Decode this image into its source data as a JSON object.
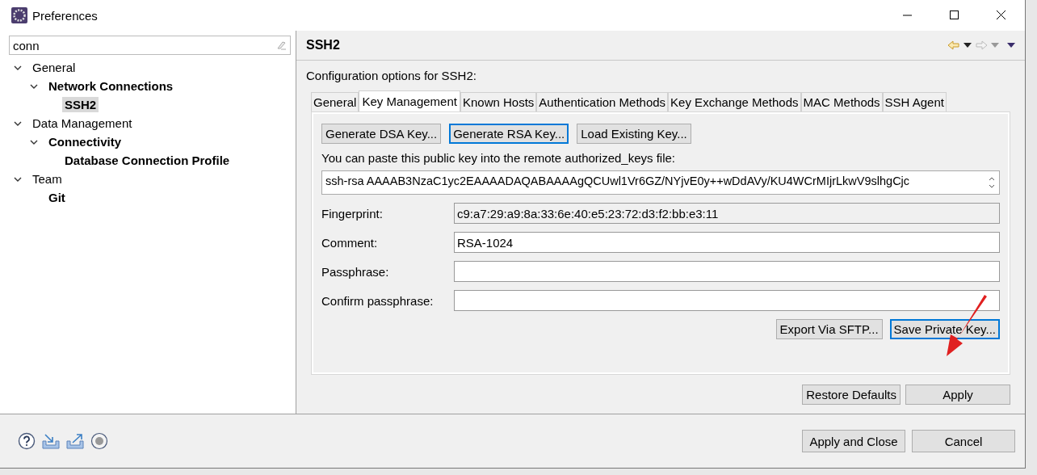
{
  "window": {
    "title": "Preferences"
  },
  "filter": {
    "value": "conn"
  },
  "tree": [
    {
      "label": "General",
      "matched": false,
      "selected": false,
      "expanded": true,
      "children": [
        {
          "label": "Network Connections",
          "matched": true,
          "selected": false,
          "expanded": true,
          "children": [
            {
              "label": "SSH2",
              "matched": true,
              "selected": true
            }
          ]
        }
      ]
    },
    {
      "label": "Data Management",
      "matched": false,
      "selected": false,
      "expanded": true,
      "children": [
        {
          "label": "Connectivity",
          "matched": true,
          "selected": false,
          "expanded": true,
          "children": [
            {
              "label": "Database Connection Profile",
              "matched": true,
              "selected": false
            }
          ]
        }
      ]
    },
    {
      "label": "Team",
      "matched": false,
      "selected": false,
      "expanded": true,
      "children": [
        {
          "label": "Git",
          "matched": true,
          "selected": false
        }
      ]
    }
  ],
  "page": {
    "title": "SSH2",
    "description": "Configuration options for SSH2:",
    "tabs": [
      {
        "label": "General",
        "selected": false
      },
      {
        "label": "Key Management",
        "selected": true
      },
      {
        "label": "Known Hosts",
        "selected": false
      },
      {
        "label": "Authentication Methods",
        "selected": false
      },
      {
        "label": "Key Exchange Methods",
        "selected": false
      },
      {
        "label": "MAC Methods",
        "selected": false
      },
      {
        "label": "SSH Agent",
        "selected": false
      }
    ],
    "key_buttons": [
      {
        "label": "Generate DSA Key...",
        "focused": false
      },
      {
        "label": "Generate RSA Key...",
        "focused": true
      },
      {
        "label": "Load Existing Key...",
        "focused": false
      }
    ],
    "public_key_label": "You can paste this public key into the remote authorized_keys file:",
    "public_key": "ssh-rsa AAAAB3NzaC1yc2EAAAADAQABAAAAgQCUwl1Vr6GZ/NYjvE0y++wDdAVy/KU4WCrMIjrLkwV9slhgCjc",
    "fields": [
      {
        "label": "Fingerprint:",
        "value": "c9:a7:29:a9:8a:33:6e:40:e5:23:72:d3:f2:bb:e3:11",
        "readonly": true
      },
      {
        "label": "Comment:",
        "value": "RSA-1024",
        "readonly": false
      },
      {
        "label": "Passphrase:",
        "readonly": false
      },
      {
        "label": "Confirm passphrase:",
        "readonly": false
      }
    ],
    "key_actions": [
      "Export Via SFTP...",
      "Save Private Key..."
    ],
    "page_buttons": [
      "Restore Defaults",
      "Apply"
    ]
  },
  "dialog_buttons": [
    "Apply and Close",
    "Cancel"
  ]
}
